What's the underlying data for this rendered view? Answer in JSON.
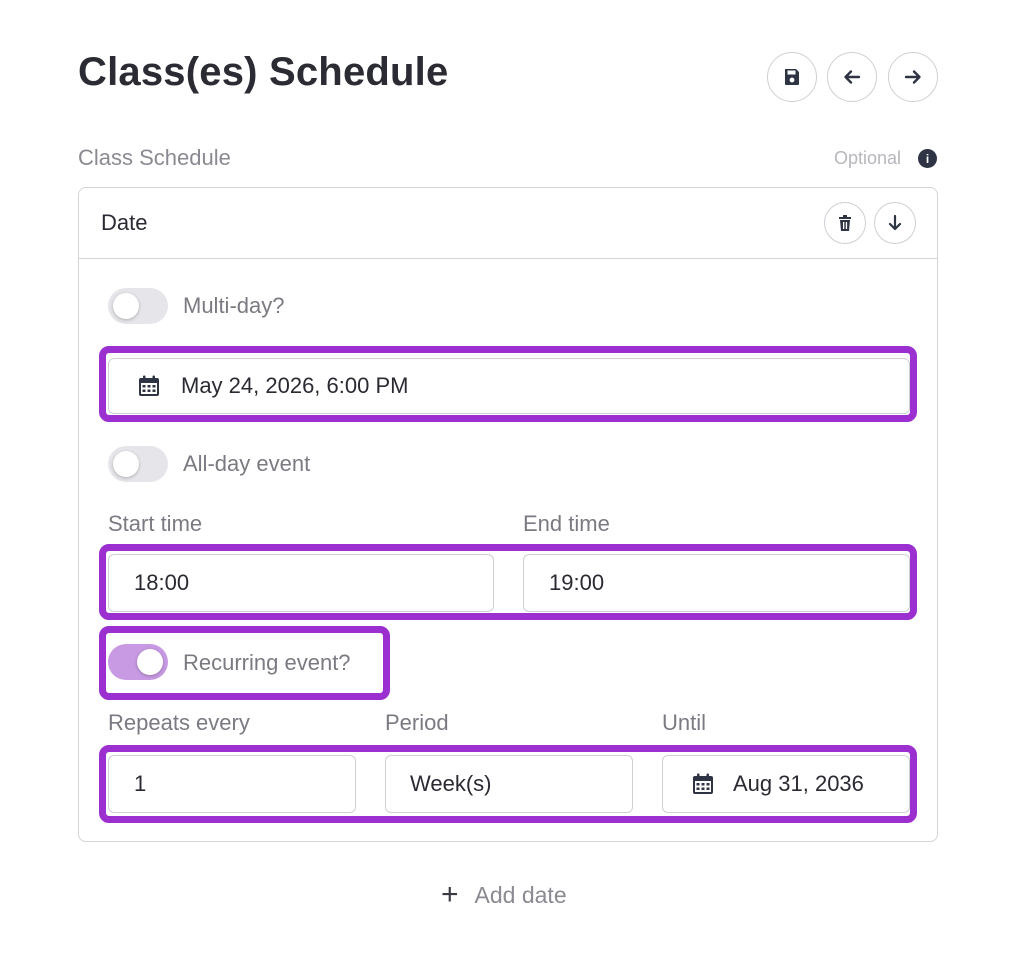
{
  "page": {
    "title": "Class(es) Schedule"
  },
  "toolbar": {
    "save_icon": "save-icon",
    "back_icon": "arrow-left-icon",
    "forward_icon": "arrow-right-icon"
  },
  "section": {
    "label": "Class Schedule",
    "optional": "Optional",
    "info_icon": "info-icon"
  },
  "date_card": {
    "title": "Date",
    "multi_day": {
      "label": "Multi-day?",
      "on": false
    },
    "date_value": "May 24, 2026, 6:00 PM",
    "all_day": {
      "label": "All-day event",
      "on": false
    },
    "start_time": {
      "label": "Start time",
      "value": "18:00"
    },
    "end_time": {
      "label": "End time",
      "value": "19:00"
    },
    "recurring": {
      "label": "Recurring event?",
      "on": true
    },
    "repeats_every": {
      "label": "Repeats every",
      "value": "1"
    },
    "period": {
      "label": "Period",
      "value": "Week(s)"
    },
    "until": {
      "label": "Until",
      "value": "Aug 31, 2036"
    }
  },
  "add_date": {
    "label": "Add date"
  },
  "colors": {
    "highlight": "#9b2fd0",
    "toggle_on": "#c79ae3",
    "toggle_off": "#e6e6ea"
  }
}
